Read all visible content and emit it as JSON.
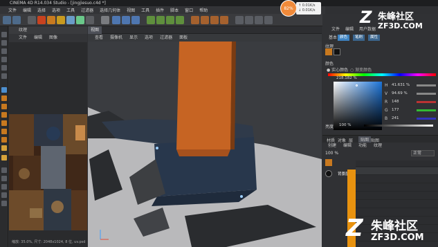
{
  "window": {
    "title": "CINEMA 4D R14.034 Studio - [jingjiesuo.c4d *]"
  },
  "menubar": {
    "items": [
      "文件",
      "编辑",
      "选择",
      "选项",
      "工具",
      "过滤器",
      "选择几何体",
      "视图",
      "工具",
      "插件",
      "脚本",
      "窗口",
      "帮助"
    ]
  },
  "texture_panel": {
    "header": "纹理",
    "menu": [
      "文件",
      "编辑",
      "图像"
    ],
    "status": "缩放: 35.0%, 尺寸: 2048x1024, 8 位, uv.psd"
  },
  "viewport": {
    "tab": "视图",
    "menu": [
      "查看",
      "摄像机",
      "显示",
      "选项",
      "过滤器",
      "面板"
    ]
  },
  "network_widget": {
    "percent": "82%",
    "upload": "0.01K/s",
    "download": "0.01K/s"
  },
  "attributes": {
    "tabs": [
      "文件",
      "编辑",
      "用户数据"
    ],
    "subtabs": [
      "基本",
      "颜色",
      "笔刷",
      "属性"
    ],
    "active_subtab": "颜色",
    "section_texture": "纹理",
    "section_color": "颜色",
    "fill_mode": "实心颜色",
    "fill_mode_alt": "渐变颜色",
    "hex_value": "218.182 %",
    "hsv": [
      {
        "label": "H",
        "value": "41.631 %"
      },
      {
        "label": "V",
        "value": "94.69 %"
      },
      {
        "label": "R",
        "value": "148"
      },
      {
        "label": "G",
        "value": "177"
      },
      {
        "label": "B",
        "value": "241"
      }
    ],
    "brightness_label": "亮度",
    "brightness_value": "100 %",
    "picked_color": "#1c74d8"
  },
  "layers": {
    "tabs": [
      "材质",
      "对象",
      "层",
      "贴图"
    ],
    "active_tab": "贴图",
    "subtabs": [
      "创建",
      "编辑",
      "功能",
      "纹理"
    ],
    "zoom": "100 %",
    "blend_mode": "正常",
    "layer_name": "背景层"
  },
  "watermark": {
    "text": "朱峰社区",
    "domain": "ZF3D.COM"
  },
  "colors": {
    "accent": "#e8920f",
    "selected_blue": "#3d83c2"
  }
}
